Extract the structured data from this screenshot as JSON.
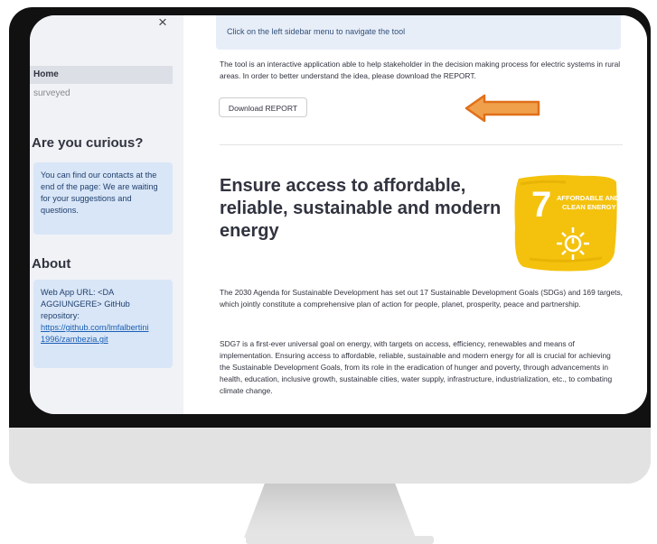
{
  "sidebar": {
    "close_glyph": "×",
    "nav": [
      {
        "label": "Home"
      },
      {
        "label": "surveyed"
      }
    ],
    "curious_heading": "Are you curious?",
    "curious_text": "You can find our contacts at the end of the page: We are waiting for your suggestions and questions.",
    "about_heading": "About",
    "about_text": "Web App URL: <DA AGGIUNGERE> GitHub repository:",
    "about_link_1": "https://github.com/lmfalbertini",
    "about_link_2": "1996/zambezia.git"
  },
  "main": {
    "banner_text": "Click on the left sidebar menu to navigate the tool",
    "intro_text": "The tool is an interactive application able to help stakeholder in the decision making process for electric systems in rural areas. In order to better understand the idea, please download the REPORT.",
    "download_button": "Download REPORT",
    "title": "Ensure access to affordable, reliable, sustainable and modern energy",
    "sdg_number": "7",
    "sdg_line1": "AFFORDABLE AND",
    "sdg_line2": "CLEAN ENERGY",
    "para1": "The 2030 Agenda for Sustainable Development has set out 17 Sustainable Development Goals (SDGs) and 169 targets, which jointly constitute a comprehensive plan of action for people, planet, prosperity, peace and partnership.",
    "para2": "SDG7 is a first-ever universal goal on energy, with targets on access, efficiency, renewables and means of implementation. Ensuring access to affordable, reliable, sustainable and modern energy for all is crucial for achieving the Sustainable Development Goals, from its role in the eradication of hunger and poverty, through advancements in health, education, inclusive growth, sustainable cities, water supply, infrastructure, industrialization, etc., to combating climate change."
  },
  "colors": {
    "sidebar_bg": "#f0f2f6",
    "info_box_bg": "#d9e6f7",
    "arrow_fill": "#f0a04b",
    "arrow_stroke": "#e0701a",
    "sdg_yellow": "#f4c20d"
  }
}
